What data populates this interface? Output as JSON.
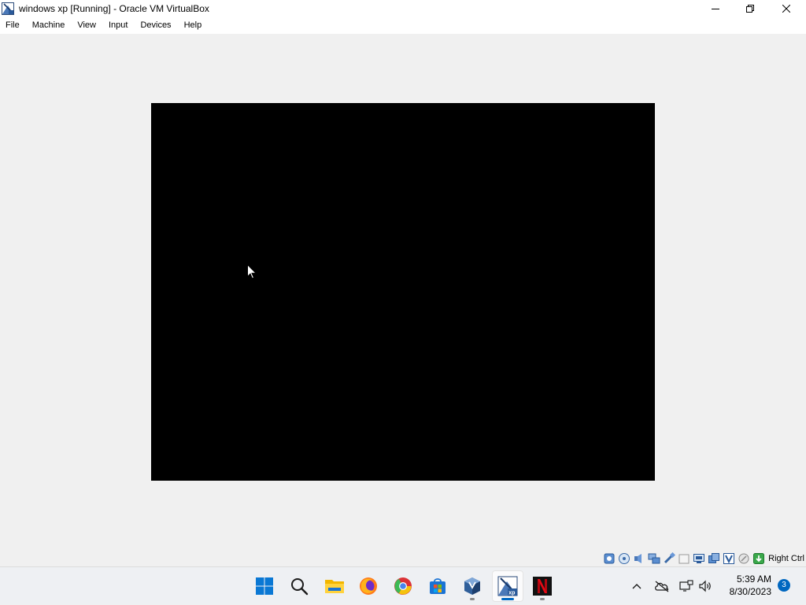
{
  "window": {
    "title": "windows xp [Running] - Oracle VM VirtualBox",
    "icon": "virtualbox-xp-icon",
    "controls": [
      "minimize-icon",
      "restore-icon",
      "close-icon"
    ]
  },
  "menu": {
    "items": [
      {
        "label": "File"
      },
      {
        "label": "Machine"
      },
      {
        "label": "View"
      },
      {
        "label": "Input"
      },
      {
        "label": "Devices"
      },
      {
        "label": "Help"
      }
    ]
  },
  "vm_display": {
    "background": "#000000",
    "cursor": "mouse-pointer-icon"
  },
  "statusbar": {
    "icons": [
      "hard-disk-icon",
      "optical-drive-icon",
      "audio-icon",
      "network-icon",
      "usb-icon",
      "shared-folders-icon",
      "display-icon",
      "video-capture-icon",
      "virtualization-icon",
      "mouse-integration-icon",
      "keyboard-icon"
    ],
    "host_key": "Right Ctrl"
  },
  "taskbar": {
    "apps": [
      {
        "name": "start-icon",
        "state": "none"
      },
      {
        "name": "search-icon",
        "state": "none"
      },
      {
        "name": "file-explorer-icon",
        "state": "none"
      },
      {
        "name": "firefox-icon",
        "state": "none"
      },
      {
        "name": "chrome-icon",
        "state": "none"
      },
      {
        "name": "microsoft-store-icon",
        "state": "none"
      },
      {
        "name": "virtualbox-icon",
        "state": "running"
      },
      {
        "name": "windows-xp-vm-icon",
        "state": "focused"
      },
      {
        "name": "netflix-icon",
        "state": "running"
      }
    ],
    "tray": {
      "icons": [
        "chevron-up-icon",
        "onedrive-offline-icon",
        "network-monitor-icon",
        "volume-icon"
      ],
      "time": "5:39 AM",
      "date": "8/30/2023",
      "notification_count": "3"
    },
    "accent_color": "#0067c0"
  }
}
